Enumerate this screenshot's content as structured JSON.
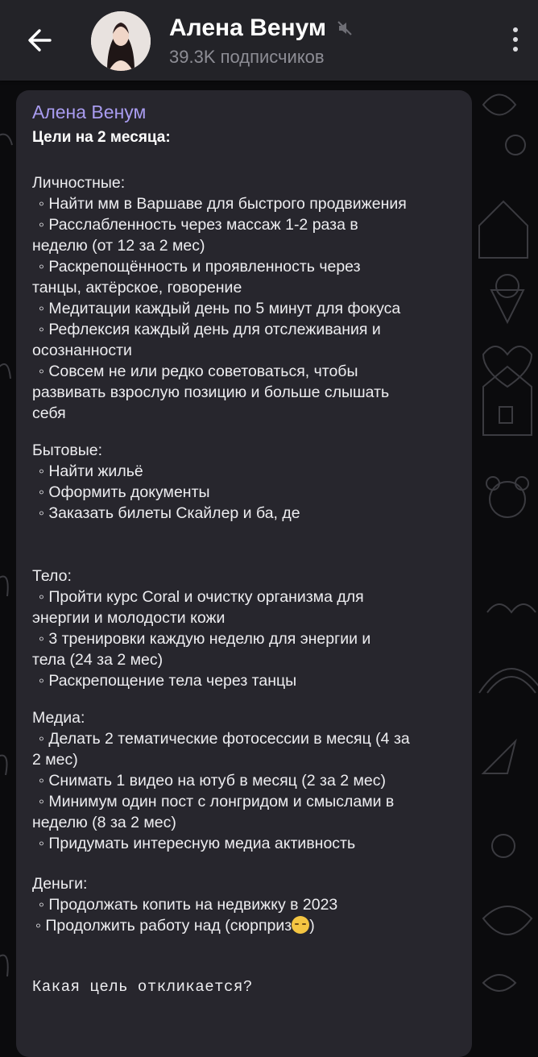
{
  "header": {
    "back_label": "Назад",
    "title": "Алена Венум",
    "subscribers": "39.3K подписчиков",
    "muted": true
  },
  "message": {
    "author": "Алена Венум",
    "title": "Цели на 2 месяца:",
    "lines": [
      "Личностные:",
      "◦  Найти мм в Варшаве для быстрого продвижения",
      "◦  Расслабленность через массаж 1-2 раза в",
      "неделю (от 12 за 2 мес)",
      "◦  Раскрепощённость и проявленность через",
      "танцы, актёрское, говорение",
      "◦  Медитации каждый день по 5 минут для фокуса",
      "◦  Рефлексия каждый день для отслеживания и",
      "осознанности",
      "◦  Совсем не или редко советоваться, чтобы",
      "развивать взрослую позицию и больше слышать",
      "себя",
      "Бытовые:",
      "◦  Найти жильё",
      "◦  Оформить документы",
      "◦  Заказать билеты Скайлер и ба, де",
      "Тело:",
      "◦  Пройти курс Coral и очистку организма для",
      "энергии и молодости кожи",
      "◦  3 тренировки каждую неделю для энергии и",
      "тела (24 за 2 мес)",
      "◦  Раскрепощение тела через танцы",
      "Медиа:",
      "◦  Делать 2 тематические фотосессии в месяц (4 за",
      "2 мес)",
      "◦  Снимать 1 видео на ютуб в месяц (2 за 2 мес)",
      "◦  Минимум один пост с лонгридом и смыслами в",
      "неделю (8 за 2 мес)",
      "◦  Придумать интересную медиа активность",
      "Деньги:",
      "◦  Продолжать копить на недвижку в 2023",
      "◦  Продолжить работу над (сюрприз",
      ")",
      "Какая цель откликается?"
    ]
  },
  "icons": {
    "back": "arrow-left-icon",
    "mute": "speaker-muted-icon",
    "more": "more-vertical-icon",
    "emoji": "smirking-face-emoji"
  },
  "colors": {
    "header_bg": "#232328",
    "bubble_bg": "#27262d",
    "author": "#a99cf0",
    "muted_text": "#8d8d95"
  }
}
